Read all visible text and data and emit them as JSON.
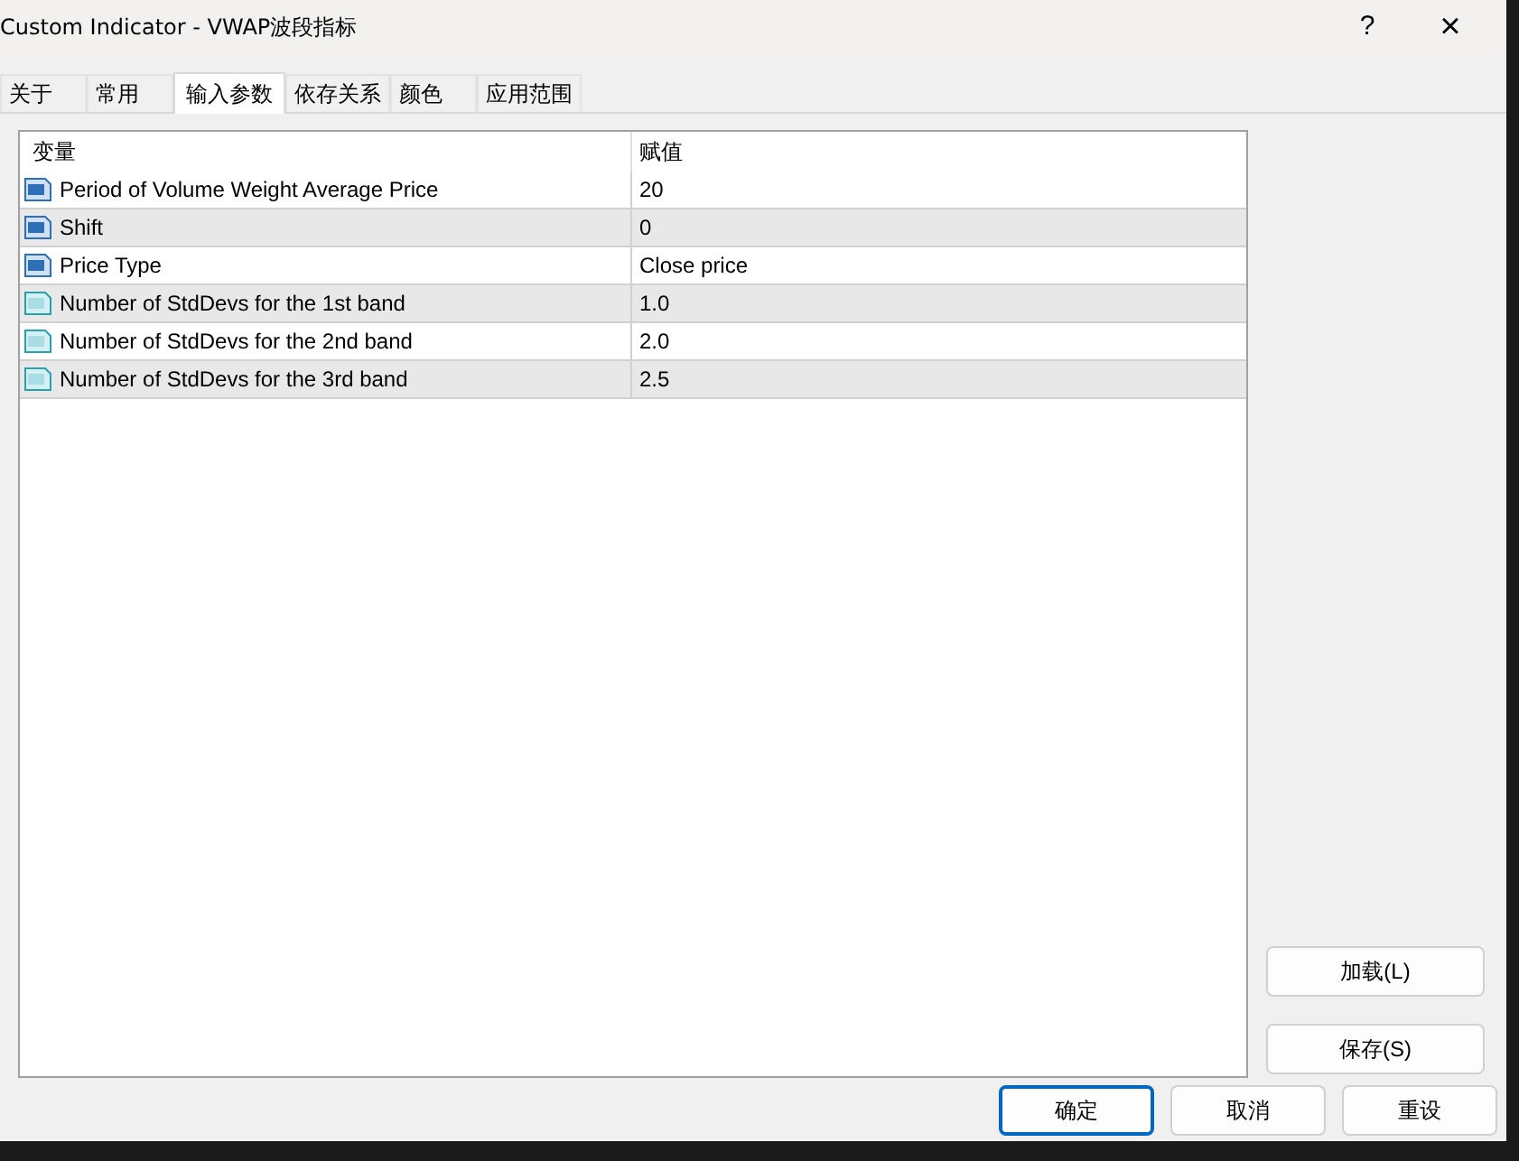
{
  "window": {
    "title": "Custom Indicator - VWAP波段指标",
    "help": "?",
    "close": "×"
  },
  "tabs": [
    {
      "label": "关于",
      "selected": false
    },
    {
      "label": "常用",
      "selected": false
    },
    {
      "label": "输入参数",
      "selected": true
    },
    {
      "label": "依存关系",
      "selected": false
    },
    {
      "label": "颜色",
      "selected": false
    },
    {
      "label": "应用范围",
      "selected": false
    }
  ],
  "table": {
    "columns": [
      "变量",
      "赋值"
    ],
    "rows": [
      {
        "kind": "integer",
        "name": "Period of Volume Weight Average Price",
        "value": "20"
      },
      {
        "kind": "integer",
        "name": "Shift",
        "value": "0"
      },
      {
        "kind": "integer",
        "name": "Price Type",
        "value": "Close price"
      },
      {
        "kind": "double",
        "name": "Number of StdDevs for the 1st band",
        "value": "1.0"
      },
      {
        "kind": "double",
        "name": "Number of StdDevs for the 2nd band",
        "value": "2.0"
      },
      {
        "kind": "double",
        "name": "Number of StdDevs for the 3rd band",
        "value": "2.5"
      }
    ]
  },
  "side_buttons": [
    "加载(L)",
    "保存(S)"
  ],
  "buttons": [
    {
      "label": "确定",
      "default": true
    },
    {
      "label": "取消",
      "default": false
    },
    {
      "label": "重设",
      "default": false
    }
  ]
}
